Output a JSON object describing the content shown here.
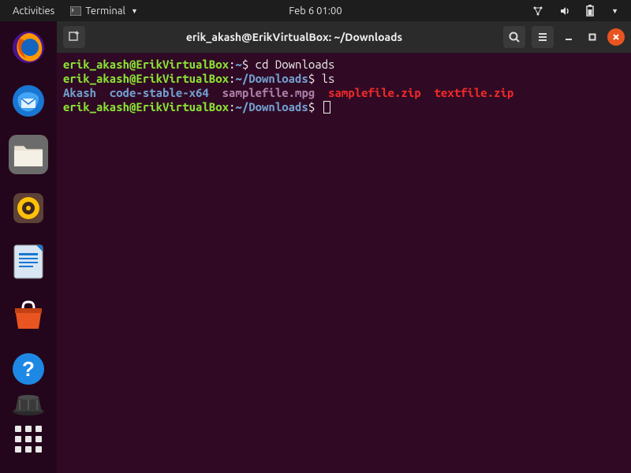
{
  "topbar": {
    "activities": "Activities",
    "app_name": "Terminal",
    "datetime": "Feb 6  01:00"
  },
  "dock": {
    "items": [
      "firefox",
      "thunderbird",
      "files",
      "rhythmbox",
      "libreoffice-writer",
      "software-center",
      "help",
      "trash",
      "show-apps"
    ]
  },
  "terminal": {
    "title": "erik_akash@ErikVirtualBox: ~/Downloads",
    "prompt_user_host": "erik_akash@ErikVirtualBox",
    "lines": [
      {
        "path": "~",
        "cmd": "cd Downloads"
      },
      {
        "path": "~/Downloads",
        "cmd": "ls"
      }
    ],
    "ls_output": {
      "dirs": [
        "Akash",
        "code-stable-x64"
      ],
      "media": [
        "samplefile.mpg"
      ],
      "archives": [
        "samplefile.zip",
        "textfile.zip"
      ]
    },
    "current_prompt_path": "~/Downloads"
  }
}
